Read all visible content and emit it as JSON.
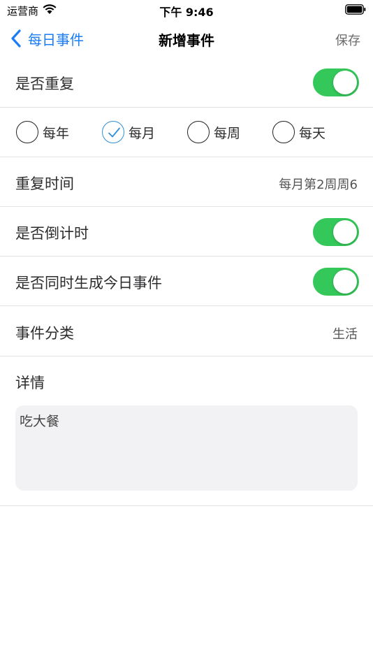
{
  "status_bar": {
    "carrier": "运营商",
    "time": "下午 9:46"
  },
  "nav": {
    "back_label": "每日事件",
    "title": "新增事件",
    "save_label": "保存"
  },
  "repeat": {
    "label": "是否重复",
    "enabled": true
  },
  "frequency": {
    "options": [
      {
        "label": "每年",
        "checked": false
      },
      {
        "label": "每月",
        "checked": true
      },
      {
        "label": "每周",
        "checked": false
      },
      {
        "label": "每天",
        "checked": false
      }
    ]
  },
  "repeat_time": {
    "label": "重复时间",
    "value": "每月第2周周6"
  },
  "countdown": {
    "label": "是否倒计时",
    "enabled": true
  },
  "create_today": {
    "label": "是否同时生成今日事件",
    "enabled": true
  },
  "category": {
    "label": "事件分类",
    "value": "生活"
  },
  "details": {
    "label": "详情",
    "text": "吃大餐"
  },
  "colors": {
    "accent": "#1a7cf6",
    "switch_on": "#34c759",
    "separator": "#e3e3e6"
  }
}
